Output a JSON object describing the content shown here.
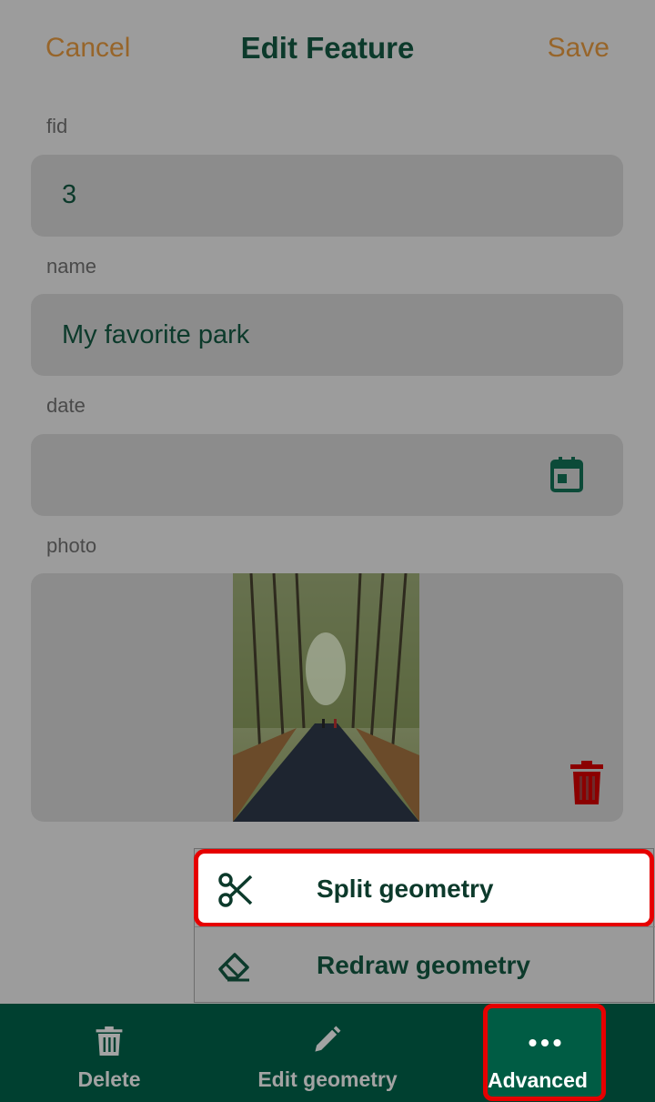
{
  "header": {
    "cancel_label": "Cancel",
    "title": "Edit Feature",
    "save_label": "Save"
  },
  "form": {
    "fields": [
      {
        "label": "fid",
        "value": "3"
      },
      {
        "label": "name",
        "value": "My favorite park"
      },
      {
        "label": "date",
        "value": "",
        "icon": "calendar-icon"
      },
      {
        "label": "photo",
        "image": "forest-path-photo",
        "icon": "trash-icon"
      }
    ]
  },
  "advanced_menu": {
    "items": [
      {
        "label": "Split geometry",
        "icon": "scissors-icon",
        "highlighted": true
      },
      {
        "label": "Redraw geometry",
        "icon": "eraser-icon"
      }
    ]
  },
  "bottom_bar": {
    "items": [
      {
        "label": "Delete",
        "icon": "trash-icon"
      },
      {
        "label": "Edit geometry",
        "icon": "pencil-icon"
      },
      {
        "label": "Advanced",
        "icon": "more-dots-icon",
        "active": true
      }
    ]
  },
  "colors": {
    "accent": "#004030",
    "header_action": "#97652a",
    "highlight_border": "#e60000",
    "delete_red": "#8b0000"
  }
}
